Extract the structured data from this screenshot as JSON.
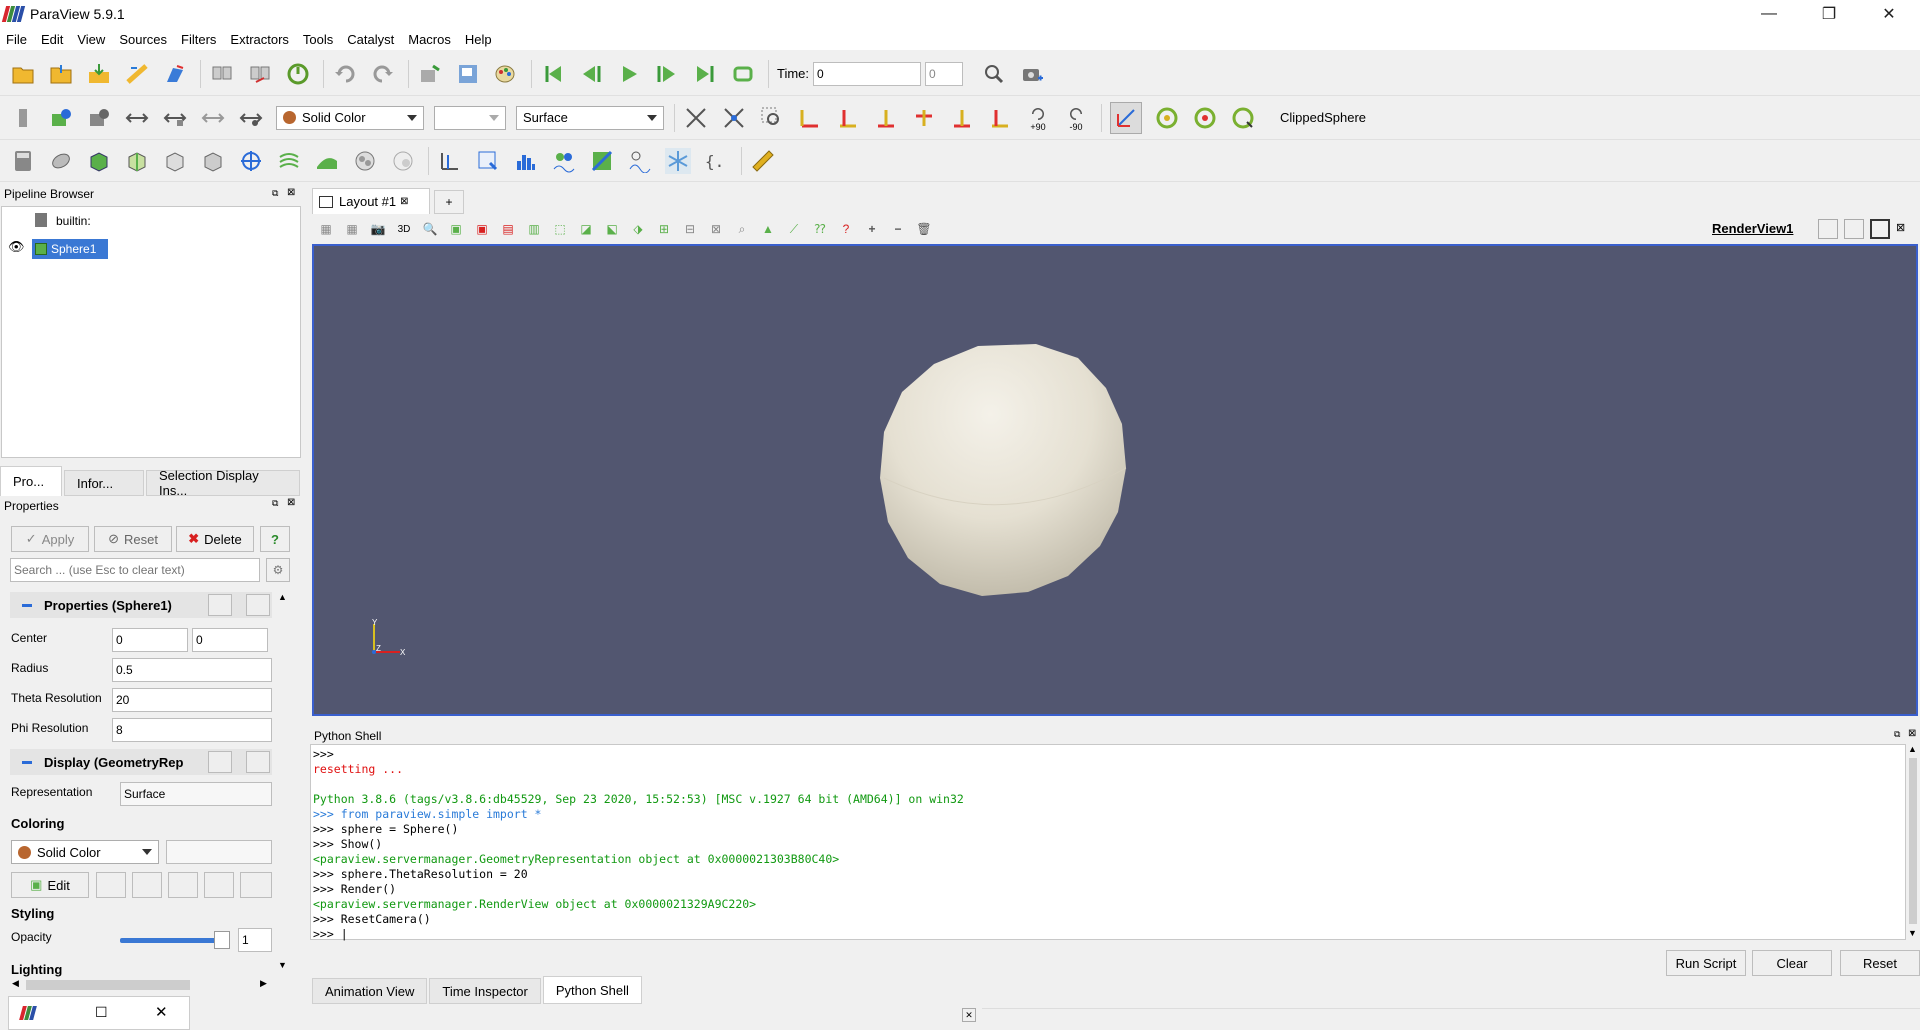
{
  "window": {
    "title": "ParaView 5.9.1",
    "minimize": "—",
    "maximize": "❐",
    "close": "✕"
  },
  "menu": [
    "File",
    "Edit",
    "View",
    "Sources",
    "Filters",
    "Extractors",
    "Tools",
    "Catalyst",
    "Macros",
    "Help"
  ],
  "toolbar1": {
    "time_label": "Time:",
    "time_value": "0",
    "time_index": "0"
  },
  "toolbar2": {
    "coloring_combo": "Solid Color",
    "component_combo": "",
    "representation_combo": "Surface",
    "rotate_plus": "+90",
    "rotate_minus": "-90",
    "active_source": "ClippedSphere"
  },
  "pipeline": {
    "title": "Pipeline Browser",
    "builtin": "builtin:",
    "sphere": "Sphere1"
  },
  "panel_tabs": [
    "Pro...",
    "Infor...",
    "Selection Display Ins..."
  ],
  "properties": {
    "title": "Properties",
    "apply": "Apply",
    "reset": "Reset",
    "delete": "Delete",
    "help": "?",
    "search_placeholder": "Search ... (use Esc to clear text)",
    "section": "Properties (Sphere1)",
    "center_label": "Center",
    "center_x": "0",
    "center_y": "0",
    "radius_label": "Radius",
    "radius": "0.5",
    "theta_label": "Theta Resolution",
    "theta": "20",
    "phi_label": "Phi Resolution",
    "phi": "8",
    "display_section": "Display (GeometryRep",
    "repr_label": "Representation",
    "repr_value": "Surface",
    "coloring_label": "Coloring",
    "coloring_value": "Solid Color",
    "edit": "Edit",
    "styling_label": "Styling",
    "opacity_label": "Opacity",
    "opacity_value": "1",
    "opacity": 1.0,
    "lighting_label": "Lighting"
  },
  "layout": {
    "tab": "Layout #1",
    "add": "+",
    "view_name": "RenderView1",
    "btn_3d": "3D"
  },
  "axes": {
    "y": "Y",
    "z": "Z",
    "x": "X"
  },
  "python": {
    "title": "Python Shell",
    "lines": [
      {
        "t": ">>>",
        "c": "#000"
      },
      {
        "t": "resetting ...",
        "c": "#e01010"
      },
      {
        "t": " ",
        "c": "#000"
      },
      {
        "t": "Python 3.8.6 (tags/v3.8.6:db45529, Sep 23 2020, 15:52:53) [MSC v.1927 64 bit (AMD64)] on win32",
        "c": "#119911"
      },
      {
        "t": ">>> from paraview.simple import *",
        "c": "#2a7bd8"
      },
      {
        "t": ">>> sphere = Sphere()",
        "c": "#000"
      },
      {
        "t": ">>> Show()",
        "c": "#000"
      },
      {
        "t": "<paraview.servermanager.GeometryRepresentation object at 0x0000021303B80C40>",
        "c": "#119911"
      },
      {
        "t": ">>> sphere.ThetaResolution = 20",
        "c": "#000"
      },
      {
        "t": ">>> Render()",
        "c": "#000"
      },
      {
        "t": "<paraview.servermanager.RenderView object at 0x0000021329A9C220>",
        "c": "#119911"
      },
      {
        "t": ">>> ResetCamera()",
        "c": "#000"
      },
      {
        "t": ">>> |",
        "c": "#000"
      }
    ],
    "run_script": "Run Script",
    "clear": "Clear",
    "reset": "Reset"
  },
  "bottom_tabs": [
    "Animation View",
    "Time Inspector",
    "Python Shell"
  ],
  "colors": {
    "viewport_bg": "#525670",
    "accent": "#3a5fcd"
  }
}
